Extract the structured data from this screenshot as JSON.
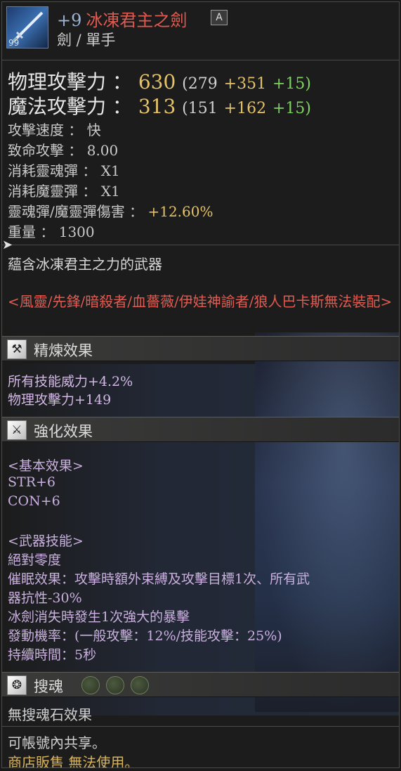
{
  "header": {
    "enhance": "+9",
    "name": "冰凍君主之劍",
    "grade": "A",
    "type": "劍 / 單手",
    "icon_level": "99"
  },
  "stats": {
    "physical": {
      "label": "物理攻擊力 ：",
      "value": "630",
      "open": "(279",
      "refine": "+351",
      "enhance": "+15)"
    },
    "magic": {
      "label": "魔法攻擊力 ：",
      "value": "313",
      "open": "(151",
      "refine": "+162",
      "enhance": "+15)"
    },
    "attack_speed": "攻擊速度 ： 快",
    "crit": "致命攻擊 ： 8.00",
    "soulshot": "消耗靈魂彈 ： X1",
    "spiritshot": "消耗魔靈彈 ： X1",
    "shot_damage_label": "靈魂彈/魔靈彈傷害 ：",
    "shot_damage_value": "+12.60%",
    "weight": "重量 ： 1300"
  },
  "description": "蘊含冰凍君主之力的武器",
  "restriction": "<風靈/先鋒/暗殺者/血薔薇/伊娃神諭者/狼人巴卡斯無法裝配>",
  "refine_section": {
    "title": "精煉效果",
    "lines": [
      "所有技能威力+4.2%",
      "物理攻擊力+149"
    ]
  },
  "enhance_section": {
    "title": "強化效果",
    "basic_header": "<基本效果>",
    "basic_lines": [
      "STR+6",
      "CON+6"
    ],
    "skill_header": "<武器技能>",
    "skill_lines": [
      "絕對零度",
      "催眠效果：攻擊時額外束縛及攻擊目標1次、所有武",
      "器抗性-30%",
      "冰劍消失時發生1次強大的暴擊",
      "發動機率：(一般攻擊：12%/技能攻擊：25%)",
      "持續時間：5秒"
    ]
  },
  "soul_section": {
    "title": "搜魂",
    "empty_text": "無搜魂石效果"
  },
  "footer": {
    "share": "可帳號內共享。",
    "shop": "商店販售 無法使用。"
  },
  "icons": {
    "refine": "anvil-icon",
    "enhance": "hammer-icon",
    "soul": "flame-icon"
  }
}
